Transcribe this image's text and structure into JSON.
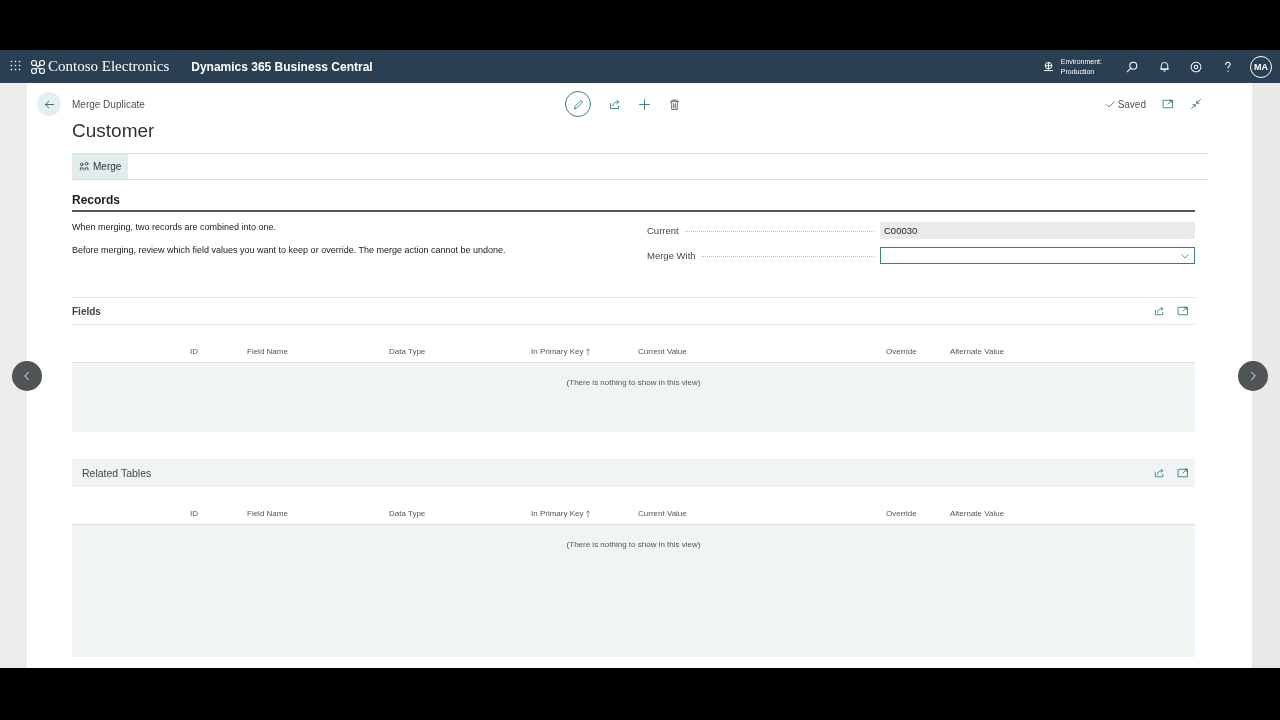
{
  "header": {
    "company": "Contoso Electronics",
    "product": "Dynamics 365 Business Central",
    "environment_label": "Environment:",
    "environment": "Production",
    "avatar": "MA"
  },
  "page": {
    "breadcrumb": "Merge Duplicate",
    "title": "Customer",
    "status": "Saved"
  },
  "actions": [
    {
      "label": "Merge"
    }
  ],
  "records": {
    "title": "Records",
    "lines": [
      "When merging, two records are combined into one.",
      "Before merging, review which field values you want to keep or override. The merge action cannot be undone."
    ],
    "fields": [
      {
        "label": "Current",
        "value": "C00030",
        "kind": "readonly"
      },
      {
        "label": "Merge With",
        "kind": "dropdown"
      }
    ]
  },
  "sections": [
    {
      "title": "Fields",
      "focused": false,
      "columns": [
        {
          "label": "ID",
          "sorted": false
        },
        {
          "label": "Field Name",
          "sorted": false
        },
        {
          "label": "Data Type",
          "sorted": false
        },
        {
          "label": "In Primary Key",
          "sorted": true
        },
        {
          "label": "Current Value",
          "sorted": false
        },
        {
          "label": "Override",
          "sorted": false
        },
        {
          "label": "Alternate Value",
          "sorted": false
        }
      ],
      "empty_text": "(There is nothing to show in this view)"
    },
    {
      "title": "Related Tables",
      "focused": true,
      "columns": [
        {
          "label": "ID",
          "sorted": false
        },
        {
          "label": "Field Name",
          "sorted": false
        },
        {
          "label": "Data Type",
          "sorted": false
        },
        {
          "label": "In Primary Key",
          "sorted": true
        },
        {
          "label": "Current Value",
          "sorted": false
        },
        {
          "label": "Override",
          "sorted": false
        },
        {
          "label": "Alternate Value",
          "sorted": false
        }
      ],
      "empty_text": "(There is nothing to show in this view)"
    }
  ]
}
